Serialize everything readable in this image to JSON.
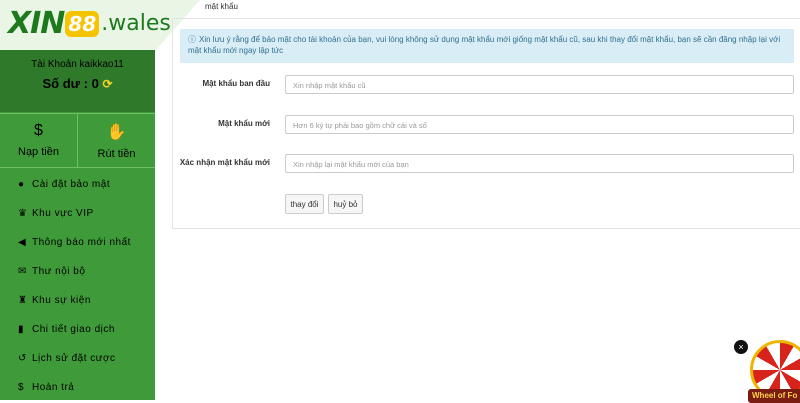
{
  "logo": {
    "xin": "XIN",
    "num": "88",
    "domain": ".wales"
  },
  "account": {
    "label": "Tài Khoản kaikkao11",
    "balance": "Số dư : 0"
  },
  "actions": [
    {
      "label": "Nạp tiền",
      "icon": "deposit-icon"
    },
    {
      "label": "Rút tiền",
      "icon": "withdraw-icon"
    }
  ],
  "menu": [
    {
      "label": "Cài đặt bảo mật",
      "icon": "user-lock-icon"
    },
    {
      "label": "Khu vực VIP",
      "icon": "crown-icon"
    },
    {
      "label": "Thông báo mới nhất",
      "icon": "megaphone-icon"
    },
    {
      "label": "Thư nội bộ",
      "icon": "mail-icon"
    },
    {
      "label": "Khu sự kiện",
      "icon": "trophy-icon"
    },
    {
      "label": "Chi tiết giao dịch",
      "icon": "clipboard-icon"
    },
    {
      "label": "Lịch sử đặt cược",
      "icon": "history-icon"
    },
    {
      "label": "Hoàn trả",
      "icon": "dollar-icon"
    }
  ],
  "breadcrumb": "mật khẩu",
  "notice": "Xin lưu ý rằng để bảo mật cho tài khoản của bạn, vui lòng không sử dụng mật khẩu mới giống mật khẩu cũ, sau khi thay đổi mật khẩu, bạn sẽ cần đăng nhập lại với mật khẩu mới ngay lập tức",
  "form": {
    "old_label": "Mật khẩu ban đầu",
    "old_placeholder": "Xin nhập mật khẩu cũ",
    "new_label": "Mật khẩu mới",
    "new_placeholder": "Hơn 6 ký tự phải bao gồm chữ cái và số",
    "confirm_label": "Xác nhận mật khẩu mới",
    "confirm_placeholder": "Xin nhập lại mật khẩu mới của bạn",
    "submit": "thay đổi",
    "cancel": "huỷ bỏ"
  },
  "wheel": {
    "label": "Wheel of Fo",
    "close": "×"
  },
  "colors": {
    "sidebar": "#3f9b3a",
    "account_bg": "#2f7a2a",
    "notice_bg": "#d9edf7",
    "notice_text": "#31708f",
    "accent_yellow": "#f4c400"
  }
}
